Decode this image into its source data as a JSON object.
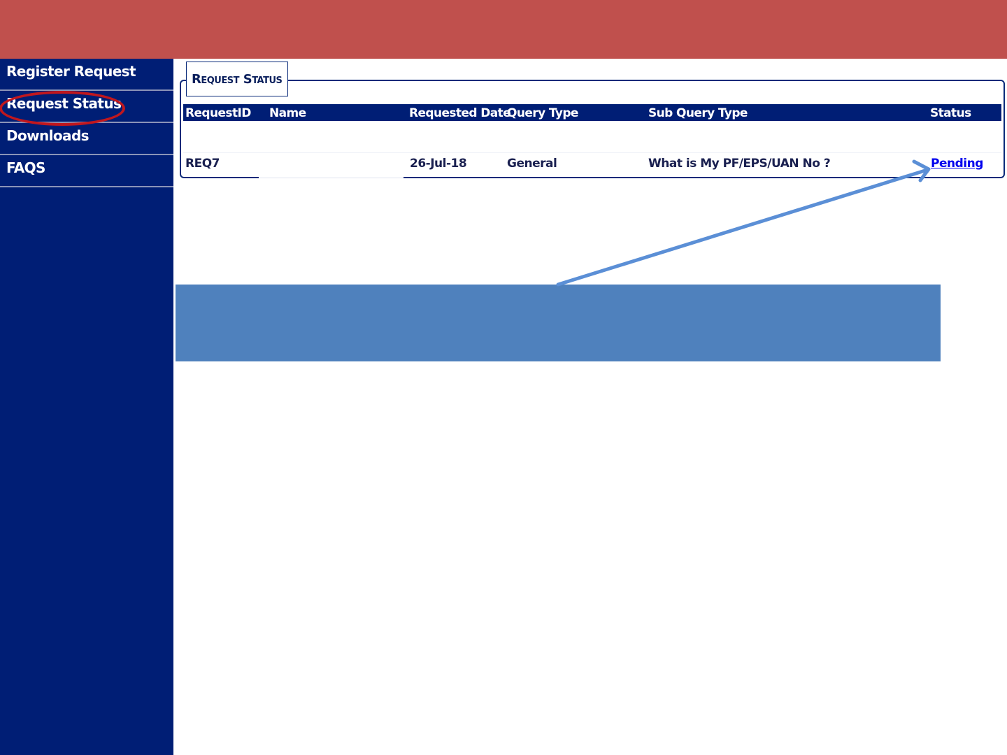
{
  "sidebar": {
    "items": [
      {
        "label": "Register Request"
      },
      {
        "label": "Request Status"
      },
      {
        "label": "Downloads"
      },
      {
        "label": "FAQS"
      }
    ]
  },
  "panel": {
    "legend": "Request Status"
  },
  "table": {
    "columns": [
      "RequestID",
      "Name",
      "Requested Date",
      "Query Type",
      "Sub Query Type",
      "Status"
    ],
    "rows": [
      {
        "request_id": "REQ7",
        "name": "",
        "requested_date": "26-Jul-18",
        "query_type": "General",
        "sub_query_type": "What is My PF/EPS/UAN No ?",
        "status": "Pending"
      }
    ]
  },
  "colors": {
    "banner": "#c0504d",
    "sidebar": "#001e75",
    "callout": "#4f81bd",
    "highlight_ring": "#c0171e",
    "status_link": "#0000ee"
  },
  "icons": {
    "annotation_arrow": "arrow-pointing-to-status-icon"
  }
}
